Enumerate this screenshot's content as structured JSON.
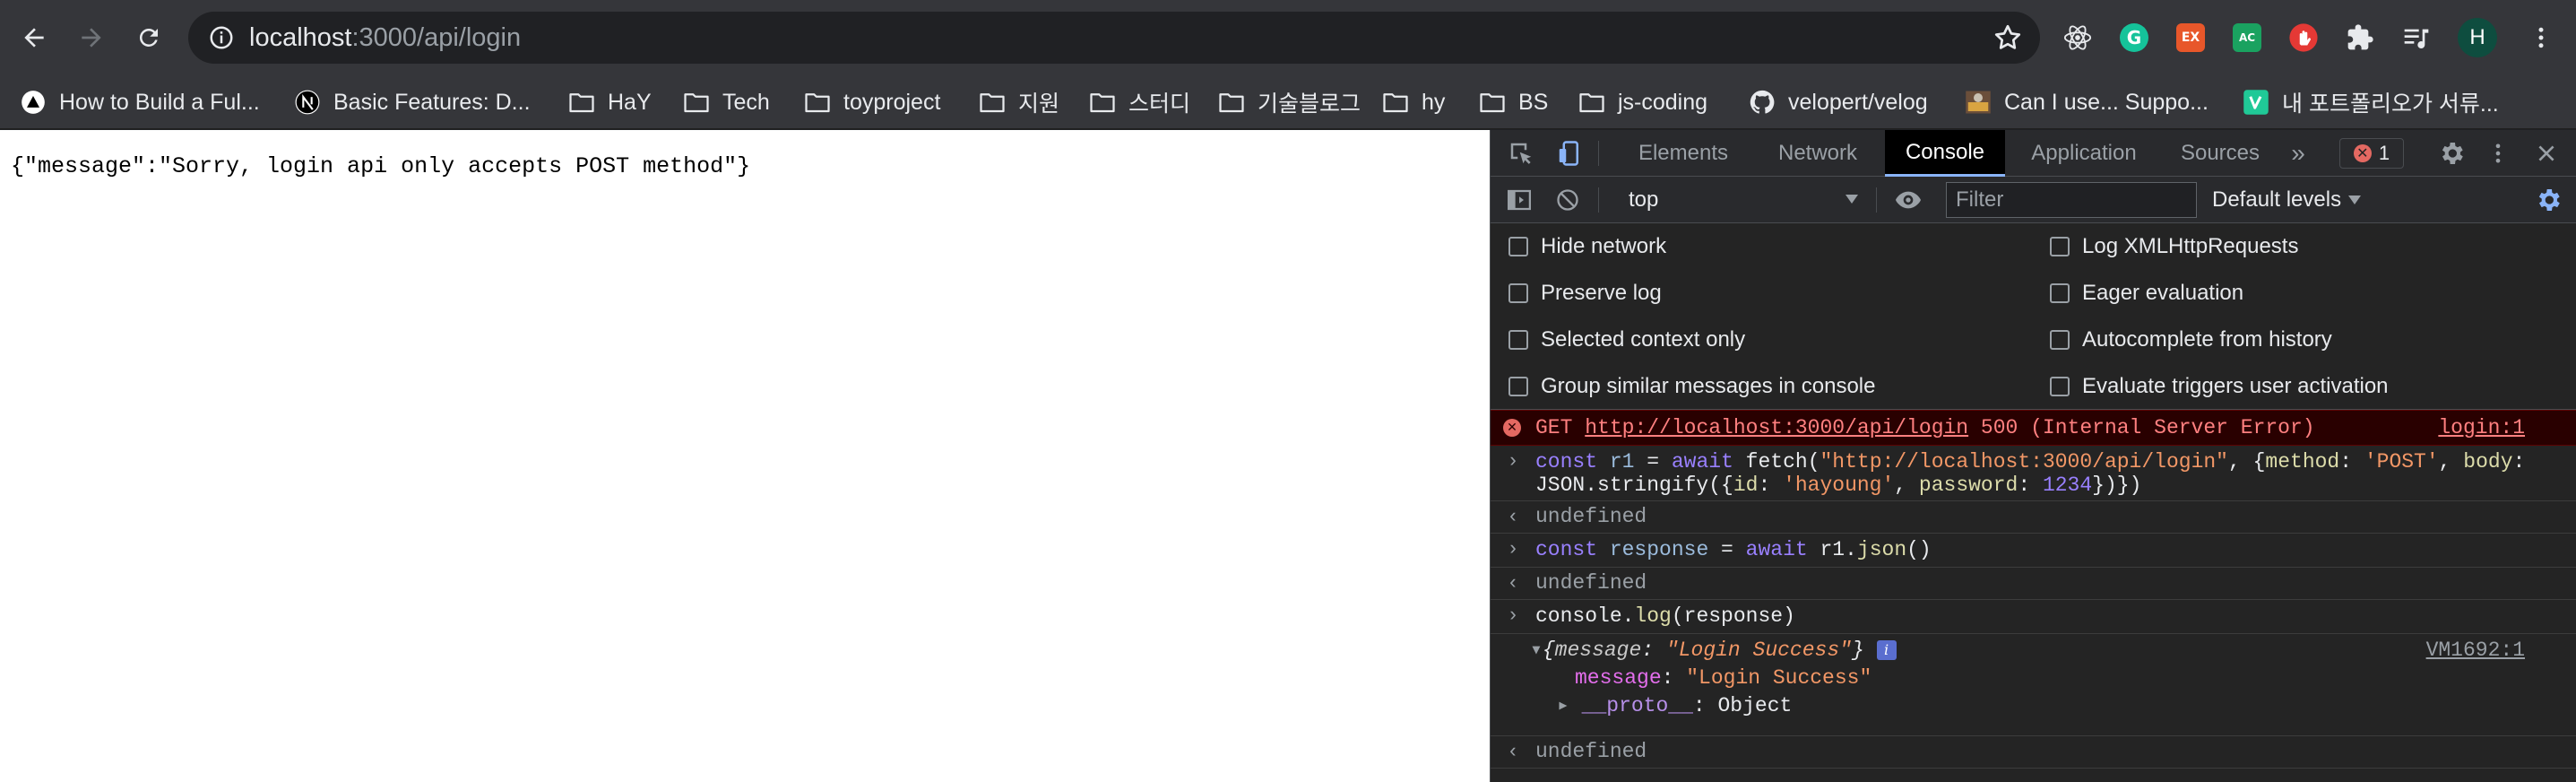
{
  "browser": {
    "url_host": "localhost",
    "url_path": ":3000/api/login",
    "profile_initial": "H",
    "extensions": [
      {
        "name": "react-devtools-icon"
      },
      {
        "name": "grammarly-icon",
        "label": "G"
      },
      {
        "name": "ex-extension-icon",
        "label": "EX"
      },
      {
        "name": "ac-extension-icon",
        "label": "AC"
      },
      {
        "name": "hand-stop-icon"
      },
      {
        "name": "puzzle-extensions-icon"
      },
      {
        "name": "media-queue-icon"
      }
    ]
  },
  "bookmarks": [
    {
      "label": "How to Build a Ful...",
      "icon": "triangle-logo-icon"
    },
    {
      "label": "Basic Features: D...",
      "icon": "nextjs-logo-icon"
    },
    {
      "label": "HaY",
      "icon": "folder-icon"
    },
    {
      "label": "Tech",
      "icon": "folder-icon"
    },
    {
      "label": "toyproject",
      "icon": "folder-icon"
    },
    {
      "label": "지원",
      "icon": "folder-icon"
    },
    {
      "label": "스터디",
      "icon": "folder-icon"
    },
    {
      "label": "기술블로그",
      "icon": "folder-icon"
    },
    {
      "label": "hy",
      "icon": "folder-icon"
    },
    {
      "label": "BS",
      "icon": "folder-icon"
    },
    {
      "label": "js-coding",
      "icon": "folder-icon"
    },
    {
      "label": "velopert/velog",
      "icon": "github-icon"
    },
    {
      "label": "Can I use... Suppo...",
      "icon": "caniuse-icon"
    },
    {
      "label": "내 포트폴리오가 서류...",
      "icon": "velog-v-icon"
    }
  ],
  "page": {
    "body_text": "{\"message\":\"Sorry, login api only accepts POST method\"}"
  },
  "devtools": {
    "tabs": [
      "Elements",
      "Network",
      "Console",
      "Application",
      "Sources"
    ],
    "active_tab": "Console",
    "more_tabs": "»",
    "error_count": "1",
    "context": "top",
    "filter_placeholder": "Filter",
    "levels": "Default levels",
    "settings": {
      "left": [
        "Hide network",
        "Preserve log",
        "Selected context only",
        "Group similar messages in console"
      ],
      "right": [
        "Log XMLHttpRequests",
        "Eager evaluation",
        "Autocomplete from history",
        "Evaluate triggers user activation"
      ]
    },
    "console": {
      "error": {
        "method": "GET",
        "url": "http://localhost:3000/api/login",
        "status": "500 (Internal Server Error)",
        "source": "login:1"
      },
      "input1_line1": {
        "kw": "const",
        "var": "r1",
        "op": " = ",
        "await": "await",
        "fn": " fetch(",
        "url": "\"http://localhost:3000/api/login\"",
        "rest1": ", {",
        "key1": "method",
        "colon": ": ",
        "val1": "'POST'",
        "comma": ", ",
        "key2": "body",
        "colon2": ":"
      },
      "input1_line2": {
        "pre": "JSON.stringify({",
        "key1": "id",
        "c1": ": ",
        "val1": "'hayoung'",
        "sep": ", ",
        "key2": "password",
        "c2": ": ",
        "val2": "1234",
        "post": "})})"
      },
      "result1": "undefined",
      "input2": {
        "kw": "const",
        "var": "response",
        "op": " = ",
        "await": "await",
        "obj": " r1.",
        "meth": "json",
        "post": "()"
      },
      "result2": "undefined",
      "input3": {
        "pre": "console.",
        "meth": "log",
        "post": "(response)"
      },
      "object_preview": {
        "open": "{",
        "key": "message",
        "colon": ": ",
        "value": "\"Login Success\"",
        "close": "}",
        "info": "i",
        "source": "VM1692:1"
      },
      "object_prop": {
        "key": "message",
        "colon": ": ",
        "value": "\"Login Success\""
      },
      "object_proto": {
        "key": "__proto__",
        "colon": ": ",
        "value": "Object"
      },
      "result3": "undefined"
    }
  },
  "colors": {
    "chrome_bg": "#35363a",
    "devtools_bg": "#242424",
    "error_red": "#e46962",
    "active_tab_underline": "#8ab4f8"
  }
}
